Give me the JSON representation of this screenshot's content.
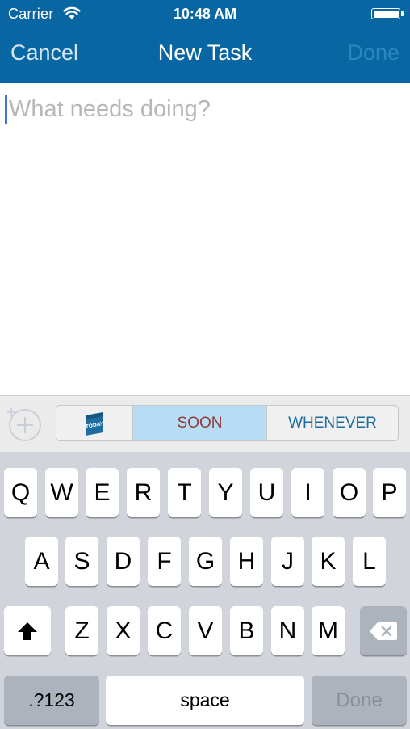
{
  "status_bar": {
    "carrier": "Carrier",
    "time": "10:48 AM"
  },
  "nav": {
    "cancel_label": "Cancel",
    "title": "New Task",
    "done_label": "Done"
  },
  "editor": {
    "placeholder": "What needs doing?",
    "value": ""
  },
  "accessory": {
    "segments": [
      {
        "label": "TODAY",
        "icon": "today-calendar-icon",
        "selected": false
      },
      {
        "label": "SOON",
        "selected": true
      },
      {
        "label": "WHENEVER",
        "selected": false
      }
    ]
  },
  "keyboard": {
    "row1": [
      "Q",
      "W",
      "E",
      "R",
      "T",
      "Y",
      "U",
      "I",
      "O",
      "P"
    ],
    "row2": [
      "A",
      "S",
      "D",
      "F",
      "G",
      "H",
      "J",
      "K",
      "L"
    ],
    "row3": [
      "Z",
      "X",
      "C",
      "V",
      "B",
      "N",
      "M"
    ],
    "numbers_label": ".?123",
    "space_label": "space",
    "done_label": "Done"
  },
  "colors": {
    "header_bg": "#0867a3",
    "selected_segment_bg": "#b8dcf3",
    "soon_text": "#8e3a3a",
    "whenever_text": "#1e6ca0",
    "keyboard_bg": "#d1d5db"
  }
}
